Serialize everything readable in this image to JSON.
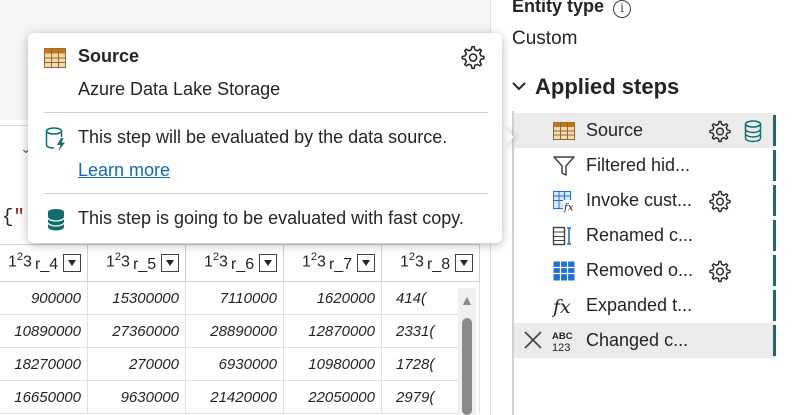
{
  "formula_fragment": {
    "brace": "{",
    "quote": "\""
  },
  "grid": {
    "columns": [
      {
        "type_base": "1",
        "type_sup": "2",
        "type_tail": "3",
        "name": "r_4"
      },
      {
        "type_base": "1",
        "type_sup": "2",
        "type_tail": "3",
        "name": "r_5"
      },
      {
        "type_base": "1",
        "type_sup": "2",
        "type_tail": "3",
        "name": "r_6"
      },
      {
        "type_base": "1",
        "type_sup": "2",
        "type_tail": "3",
        "name": "r_7"
      },
      {
        "type_base": "1",
        "type_sup": "2",
        "type_tail": "3",
        "name": "r_8"
      }
    ],
    "rows": [
      [
        "900000",
        "15300000",
        "7110000",
        "1620000",
        "414("
      ],
      [
        "10890000",
        "27360000",
        "28890000",
        "12870000",
        "2331("
      ],
      [
        "18270000",
        "270000",
        "6930000",
        "10980000",
        "1728("
      ],
      [
        "16650000",
        "9630000",
        "21420000",
        "22050000",
        "2979("
      ]
    ]
  },
  "side_pane": {
    "entity_type_label": "Entity type",
    "entity_info_glyph": "i",
    "entity_type_value": "Custom",
    "applied_steps_title": "Applied steps",
    "steps": [
      {
        "label": "Source",
        "icon": "table-icon",
        "gear": true,
        "db": true
      },
      {
        "label": "Filtered hid...",
        "icon": "filter-icon",
        "gear": false
      },
      {
        "label": "Invoke cust...",
        "icon": "function-table-icon",
        "gear": true
      },
      {
        "label": "Renamed c...",
        "icon": "rename-column-icon",
        "gear": false
      },
      {
        "label": "Removed o...",
        "icon": "grid-table-icon",
        "gear": true
      },
      {
        "label": "Expanded t...",
        "icon": "fx-icon",
        "gear": false
      },
      {
        "label": "Changed c...",
        "icon": "abc-123-icon",
        "gear": false,
        "selected": true,
        "type_top": "ABC",
        "type_bottom": "123"
      }
    ]
  },
  "popup": {
    "title": "Source",
    "subtitle": "Azure Data Lake Storage",
    "eval_text": "This step will be evaluated by the data source.",
    "learn_more": "Learn more",
    "fast_copy_text": "This step is going to be evaluated with fast copy."
  },
  "colors": {
    "accent_teal": "#0f6e6e",
    "link_blue": "#0f6cbd",
    "table_icon_orange": "#c1771a",
    "grid_icon_blue": "#1e6fd9"
  }
}
